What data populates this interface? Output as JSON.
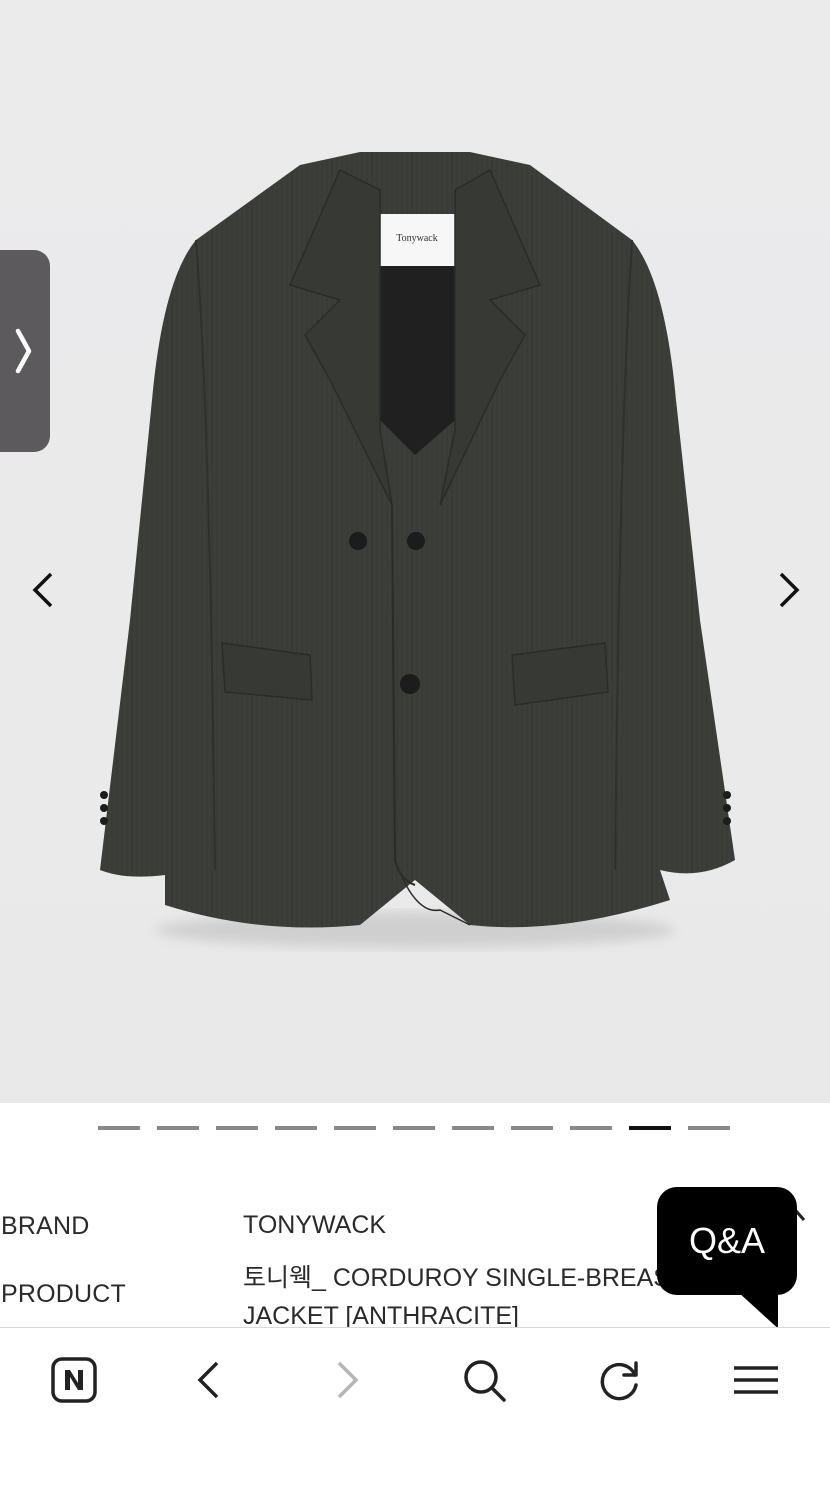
{
  "product": {
    "brand_label": "BRAND",
    "brand_value": "TONYWACK",
    "product_label": "PRODUCT",
    "product_line1": "토니웩_ CORDUROY SINGLE-BREASTED",
    "product_line2": "JACKET [ANTHRACITE]",
    "tag_text": "Tonywack"
  },
  "gallery": {
    "total_slides": 11,
    "active_slide": 10
  },
  "qa_button": {
    "label": "Q&A"
  },
  "toolbar": {
    "items": [
      "naver-home",
      "back",
      "forward",
      "search",
      "reload",
      "menu"
    ]
  },
  "colors": {
    "jacket": "#3a3d38",
    "background": "#eaeaeb",
    "toolbar_icon": "#222222",
    "disabled_icon": "#b5b5b5"
  }
}
